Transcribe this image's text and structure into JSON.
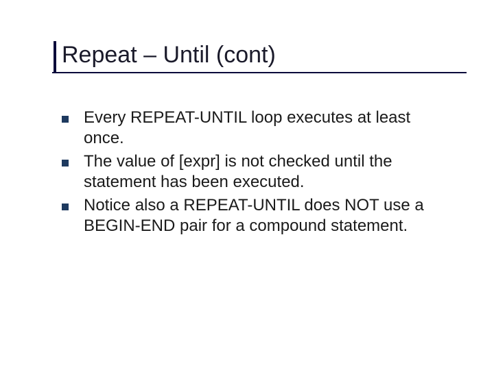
{
  "title": "Repeat – Until  (cont)",
  "bullets": [
    {
      "text": "Every REPEAT-UNTIL loop executes at least once."
    },
    {
      "text": "The value of [expr] is not checked until the statement has been executed."
    },
    {
      "text": "Notice also a REPEAT-UNTIL does NOT use a BEGIN-END pair for a compound statement."
    }
  ]
}
